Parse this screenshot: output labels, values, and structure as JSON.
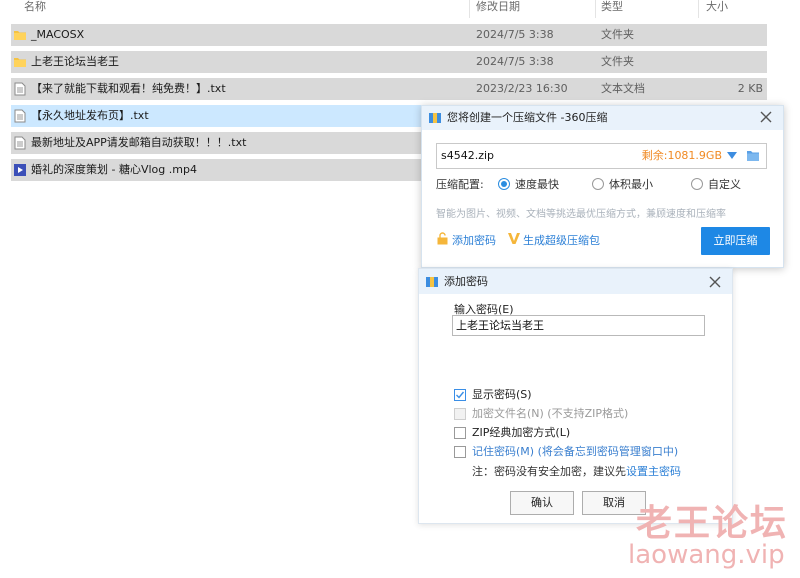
{
  "columns": {
    "name": "名称",
    "date": "修改日期",
    "type": "类型",
    "size": "大小"
  },
  "files": [
    {
      "icon": "folder-icon",
      "name": "_MACOSX",
      "date": "2024/7/5 3:38",
      "type": "文件夹",
      "size": ""
    },
    {
      "icon": "folder-icon",
      "name": "上老王论坛当老王",
      "date": "2024/7/5 3:38",
      "type": "文件夹",
      "size": ""
    },
    {
      "icon": "text-file-icon",
      "name": "【来了就能下载和观看！纯免费！】.txt",
      "date": "2023/2/23 16:30",
      "type": "文本文档",
      "size": "2 KB"
    },
    {
      "icon": "text-file-icon",
      "name": "【永久地址发布页】.txt",
      "date": "",
      "type": "",
      "size": ""
    },
    {
      "icon": "text-file-icon",
      "name": "最新地址及APP请发邮箱自动获取！！！.txt",
      "date": "",
      "type": "",
      "size": ""
    },
    {
      "icon": "video-file-icon",
      "name": "婚礼的深度策划 - 糖心Vlog .mp4",
      "date": "",
      "type": "",
      "size": ""
    }
  ],
  "compress_dialog": {
    "title": "您将创建一个压缩文件 -360压缩",
    "filename": "s4542.zip",
    "remaining": "剩余:1081.9GB",
    "config_label": "压缩配置:",
    "options": [
      "速度最快",
      "体积最小",
      "自定义"
    ],
    "selected_option": "速度最快",
    "tip": "智能为图片、视频、文档等挑选最优压缩方式，兼顾速度和压缩率",
    "add_password": "添加密码",
    "super_package": "生成超级压缩包",
    "compress_button": "立即压缩"
  },
  "password_dialog": {
    "title": "添加密码",
    "input_label": "输入密码(E)",
    "password_value": "上老王论坛当老王",
    "show_password": "显示密码(S)",
    "encrypt_filename": "加密文件名(N) (不支持ZIP格式)",
    "zip_classic": "ZIP经典加密方式(L)",
    "remember_password": "记住密码(M) (将会备忘到密码管理窗口中)",
    "note_prefix": "注：密码没有安全加密，建议先",
    "note_link": "设置主密码",
    "ok": "确认",
    "cancel": "取消"
  },
  "watermark": {
    "cn": "老王论坛",
    "en": "laowang.vip"
  },
  "colors": {
    "accent": "#1e88e5",
    "remaining": "#f08a24",
    "row_gray": "#d9d9d9",
    "row_selected": "#cce8ff",
    "watermark": "#f0b3b3"
  }
}
